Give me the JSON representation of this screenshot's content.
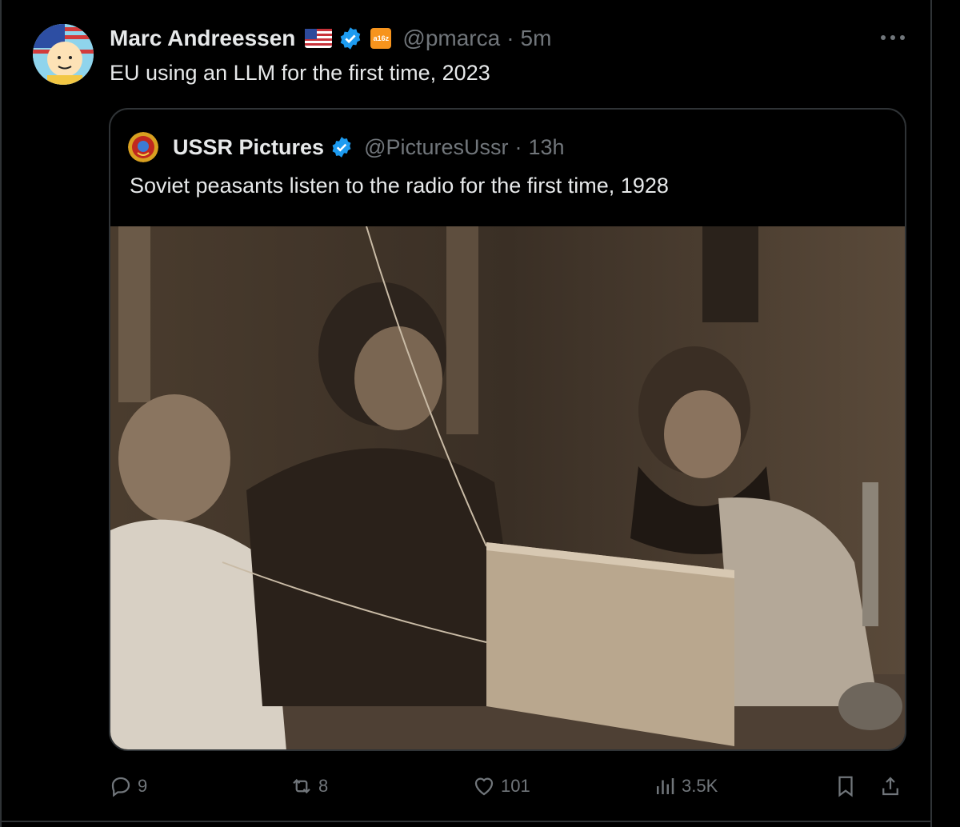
{
  "tweet": {
    "author_name": "Marc Andreessen",
    "badge_label": "a16z",
    "handle": "@pmarca",
    "separator": "·",
    "time": "5m",
    "text": "EU using an LLM for the first time, 2023"
  },
  "quote": {
    "author_name": "USSR Pictures",
    "handle": "@PicturesUssr",
    "separator": "·",
    "time": "13h",
    "text": "Soviet peasants listen to the radio for the first time, 1928"
  },
  "actions": {
    "replies": "9",
    "reposts": "8",
    "likes": "101",
    "views": "3.5K"
  },
  "colors": {
    "background": "#000000",
    "text": "#e7e9ea",
    "muted": "#71767b",
    "border": "#2f3336",
    "verified": "#1d9bf0"
  },
  "icons": [
    "more-icon",
    "verified-icon",
    "flag-icon",
    "reply-icon",
    "repost-icon",
    "like-icon",
    "views-icon",
    "bookmark-icon",
    "share-icon"
  ]
}
